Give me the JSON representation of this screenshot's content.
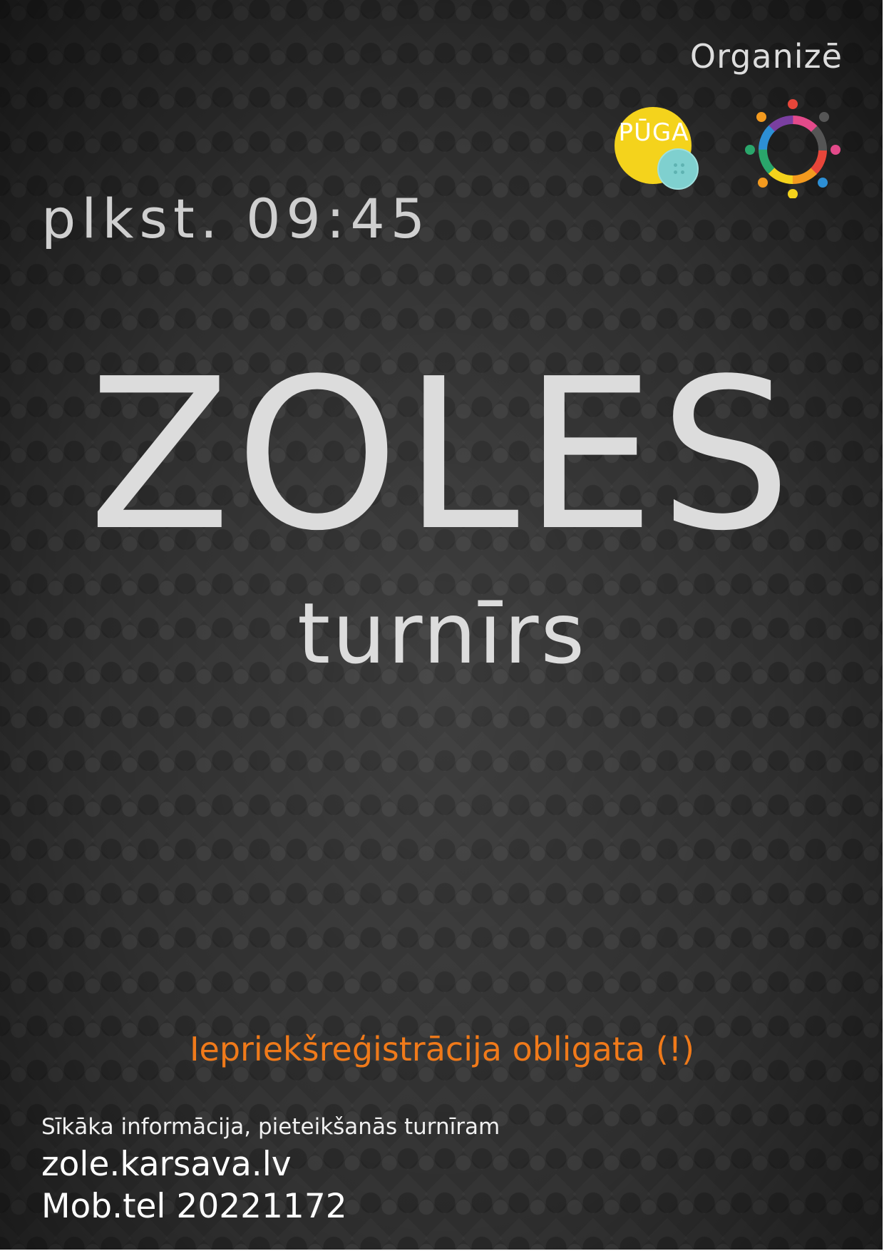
{
  "header": {
    "organizer_label": "Organizē"
  },
  "logos": {
    "puga": {
      "label": "PŪGA",
      "icon": "button-logo",
      "colors": {
        "circle": "#f4d31c",
        "button": "#7fd0cf"
      }
    },
    "community_ring": {
      "icon": "people-ring-logo",
      "colors": [
        "#e8463a",
        "#f39a1f",
        "#f4d31c",
        "#2aa66b",
        "#2d8fd5",
        "#7a3fa0",
        "#e34a8a",
        "#555555"
      ]
    }
  },
  "event": {
    "time": "plkst. 09:45",
    "title": "ZOLES",
    "subtitle": "turnīrs"
  },
  "notice": {
    "registration": "Iepriekšreģistrācija obligata (!)",
    "color": "#f07a1a"
  },
  "contact": {
    "info_line": "Sīkāka informācija, pieteikšanās turnīram",
    "website": "zole.karsava.lv",
    "phone": "Mob.tel 20221172"
  }
}
